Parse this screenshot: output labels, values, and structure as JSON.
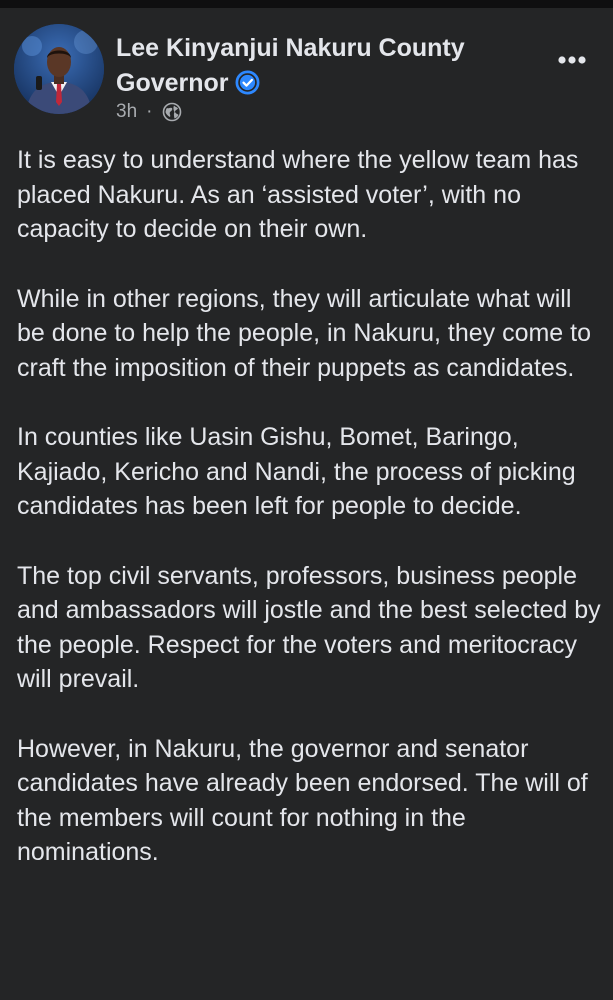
{
  "post": {
    "author": {
      "name": "Lee Kinyanjui Nakuru County Governor",
      "verified": true,
      "avatar_icon": "person-portrait-avatar"
    },
    "meta": {
      "time": "3h",
      "separator": "·",
      "audience_icon": "globe-icon"
    },
    "menu_icon": "more-options-icon",
    "paragraphs": [
      "It is easy to understand where the yellow team has placed Nakuru. As an ‘assisted voter’, with no capacity to decide on their own.",
      "While in other regions, they will articulate what will be done to help the people, in Nakuru, they come to craft the imposition of their puppets as candidates.",
      "In  counties like Uasin Gishu, Bomet, Baringo, Kajiado, Kericho and Nandi, the process of picking candidates has been left for people to decide.",
      "The top civil servants, professors, business people and ambassadors will jostle and the best selected by the people. Respect for the voters and meritocracy will prevail.",
      "However, in Nakuru, the governor and senator candidates have already been endorsed. The will of the members will count for nothing in the nominations."
    ]
  },
  "colors": {
    "background": "#242526",
    "text_primary": "#e4e6eb",
    "text_secondary": "#a8abaf",
    "verified_badge": "#2d88ff"
  }
}
